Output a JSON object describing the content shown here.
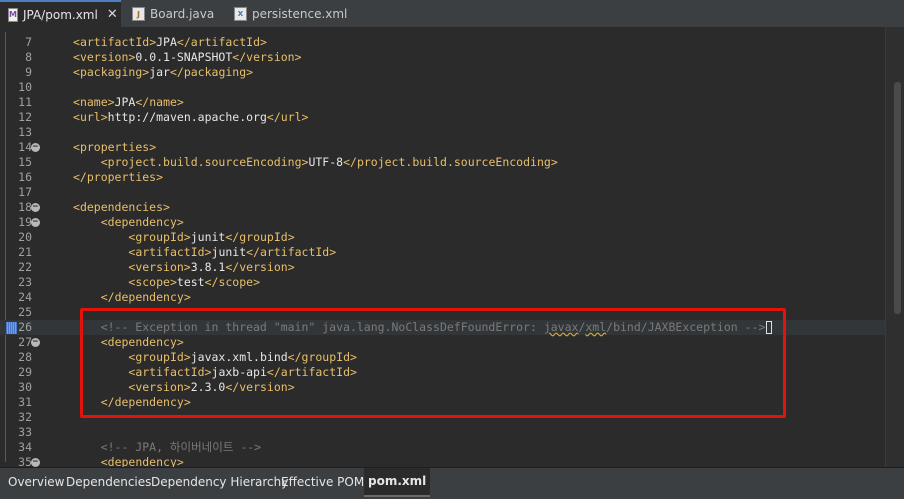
{
  "tabs": [
    {
      "label": "JPA/pom.xml",
      "icon": "maven-file-icon",
      "active": true
    },
    {
      "label": "Board.java",
      "icon": "java-file-icon",
      "active": false
    },
    {
      "label": "persistence.xml",
      "icon": "xml-file-icon",
      "active": false
    }
  ],
  "editor": {
    "lines": [
      {
        "n": "7",
        "code": "<artifactId>JPA</artifactId>"
      },
      {
        "n": "8",
        "code": "<version>0.0.1-SNAPSHOT</version>"
      },
      {
        "n": "9",
        "code": "<packaging>jar</packaging>"
      },
      {
        "n": "10",
        "code": ""
      },
      {
        "n": "11",
        "code": "<name>JPA</name>"
      },
      {
        "n": "12",
        "code": "<url>http://maven.apache.org</url>"
      },
      {
        "n": "13",
        "code": ""
      },
      {
        "n": "14",
        "code": "<properties>"
      },
      {
        "n": "15",
        "code": "    <project.build.sourceEncoding>UTF-8</project.build.sourceEncoding>"
      },
      {
        "n": "16",
        "code": "</properties>"
      },
      {
        "n": "17",
        "code": ""
      },
      {
        "n": "18",
        "code": "<dependencies>"
      },
      {
        "n": "19",
        "code": "    <dependency>"
      },
      {
        "n": "20",
        "code": "        <groupId>junit</groupId>"
      },
      {
        "n": "21",
        "code": "        <artifactId>junit</artifactId>"
      },
      {
        "n": "22",
        "code": "        <version>3.8.1</version>"
      },
      {
        "n": "23",
        "code": "        <scope>test</scope>"
      },
      {
        "n": "24",
        "code": "    </dependency>"
      },
      {
        "n": "25",
        "code": ""
      },
      {
        "n": "26",
        "code": "    <!-- Exception in thread \"main\" java.lang.NoClassDefFoundError: javax/xml/bind/JAXBException -->"
      },
      {
        "n": "27",
        "code": "    <dependency>"
      },
      {
        "n": "28",
        "code": "        <groupId>javax.xml.bind</groupId>"
      },
      {
        "n": "29",
        "code": "        <artifactId>jaxb-api</artifactId>"
      },
      {
        "n": "30",
        "code": "        <version>2.3.0</version>"
      },
      {
        "n": "31",
        "code": "    </dependency>"
      },
      {
        "n": "32",
        "code": ""
      },
      {
        "n": "33",
        "code": ""
      },
      {
        "n": "34",
        "code": "    <!-- JPA, 하이버네이트 -->"
      },
      {
        "n": "35",
        "code": "    <dependency>"
      }
    ],
    "fold_lines": [
      "14",
      "18",
      "19",
      "27",
      "35"
    ],
    "current_line": "26"
  },
  "bottom_tabs": [
    {
      "label": "Overview",
      "active": false
    },
    {
      "label": "Dependencies",
      "active": false
    },
    {
      "label": "Dependency Hierarchy",
      "active": false
    },
    {
      "label": "Effective POM",
      "active": false
    },
    {
      "label": "pom.xml",
      "active": true
    }
  ],
  "colors": {
    "highlight_box": "#e3120b",
    "tag": "#e8bf6a",
    "comment": "#7a7a7a",
    "text": "#e6e6e6"
  }
}
